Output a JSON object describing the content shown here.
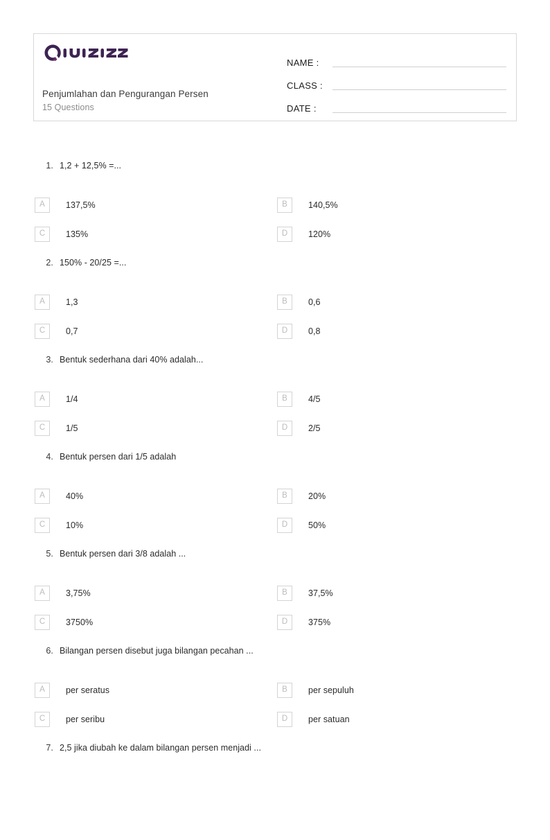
{
  "header": {
    "logo_text": "Quizizz",
    "logo_icon": "quizizz-logo",
    "logo_color": "#3d2352",
    "title": "Penjumlahan dan Pengurangan Persen",
    "subtitle": "15 Questions",
    "fields": [
      {
        "label": "NAME :",
        "value": ""
      },
      {
        "label": "CLASS :",
        "value": ""
      },
      {
        "label": "DATE  :",
        "value": ""
      }
    ]
  },
  "questions": [
    {
      "number": "1.",
      "text": "1,2 + 12,5% =...",
      "options": [
        {
          "letter": "A",
          "text": "137,5%"
        },
        {
          "letter": "B",
          "text": "140,5%"
        },
        {
          "letter": "C",
          "text": "135%"
        },
        {
          "letter": "D",
          "text": "120%"
        }
      ]
    },
    {
      "number": "2.",
      "text": "150% - 20/25 =...",
      "options": [
        {
          "letter": "A",
          "text": "1,3"
        },
        {
          "letter": "B",
          "text": "0,6"
        },
        {
          "letter": "C",
          "text": "0,7"
        },
        {
          "letter": "D",
          "text": "0,8"
        }
      ]
    },
    {
      "number": "3.",
      "text": "Bentuk sederhana dari 40% adalah...",
      "options": [
        {
          "letter": "A",
          "text": "1/4"
        },
        {
          "letter": "B",
          "text": "4/5"
        },
        {
          "letter": "C",
          "text": "1/5"
        },
        {
          "letter": "D",
          "text": "2/5"
        }
      ]
    },
    {
      "number": "4.",
      "text": "Bentuk persen dari 1/5 adalah",
      "options": [
        {
          "letter": "A",
          "text": "40%"
        },
        {
          "letter": "B",
          "text": "20%"
        },
        {
          "letter": "C",
          "text": "10%"
        },
        {
          "letter": "D",
          "text": "50%"
        }
      ]
    },
    {
      "number": "5.",
      "text": "Bentuk persen dari 3/8 adalah ...",
      "options": [
        {
          "letter": "A",
          "text": "3,75%"
        },
        {
          "letter": "B",
          "text": "37,5%"
        },
        {
          "letter": "C",
          "text": "3750%"
        },
        {
          "letter": "D",
          "text": "375%"
        }
      ]
    },
    {
      "number": "6.",
      "text": "Bilangan persen disebut juga bilangan pecahan ...",
      "options": [
        {
          "letter": "A",
          "text": "per seratus"
        },
        {
          "letter": "B",
          "text": "per sepuluh"
        },
        {
          "letter": "C",
          "text": "per seribu"
        },
        {
          "letter": "D",
          "text": "per satuan"
        }
      ]
    },
    {
      "number": "7.",
      "text": "2,5 jika diubah ke dalam bilangan persen menjadi ...",
      "options": []
    }
  ]
}
